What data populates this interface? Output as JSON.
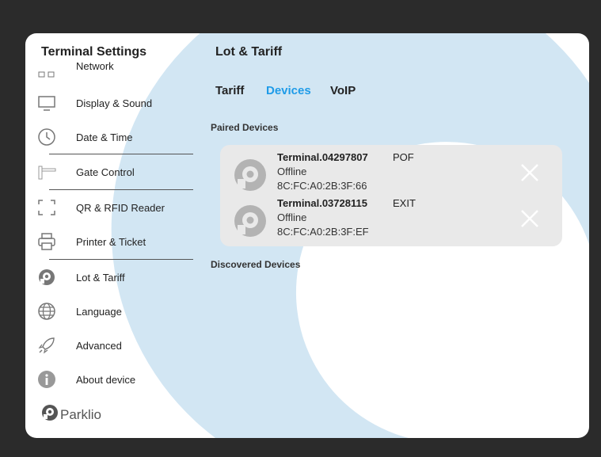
{
  "sidebar": {
    "title": "Terminal Settings",
    "items": [
      {
        "label": "Network",
        "icon": "network-icon"
      },
      {
        "label": "Display & Sound",
        "icon": "monitor-icon"
      },
      {
        "label": "Date & Time",
        "icon": "clock-icon"
      },
      {
        "label": "Gate Control",
        "icon": "barrier-gate-icon"
      },
      {
        "label": "QR & RFID Reader",
        "icon": "scanner-icon"
      },
      {
        "label": "Printer & Ticket",
        "icon": "printer-icon"
      },
      {
        "label": "Lot & Tariff",
        "icon": "parklio-icon"
      },
      {
        "label": "Language",
        "icon": "globe-icon"
      },
      {
        "label": "Advanced",
        "icon": "rocket-icon"
      },
      {
        "label": "About device",
        "icon": "info-icon"
      }
    ],
    "brand": "Parklio"
  },
  "main": {
    "title": "Lot & Tariff",
    "tabs": [
      {
        "label": "Tariff",
        "active": false
      },
      {
        "label": "Devices",
        "active": true
      },
      {
        "label": "VoIP",
        "active": false
      }
    ],
    "paired_title": "Paired Devices",
    "discovered_title": "Discovered Devices",
    "devices": [
      {
        "name": "Terminal.04297807",
        "type": "POF",
        "status": "Offline",
        "mac": "8C:FC:A0:2B:3F:66"
      },
      {
        "name": "Terminal.03728115",
        "type": "EXIT",
        "status": "Offline",
        "mac": "8C:FC:A0:2B:3F:EF"
      }
    ]
  },
  "colors": {
    "accent": "#1e9be8",
    "ring": "#d2e6f3",
    "background": "#2b2b2b"
  }
}
